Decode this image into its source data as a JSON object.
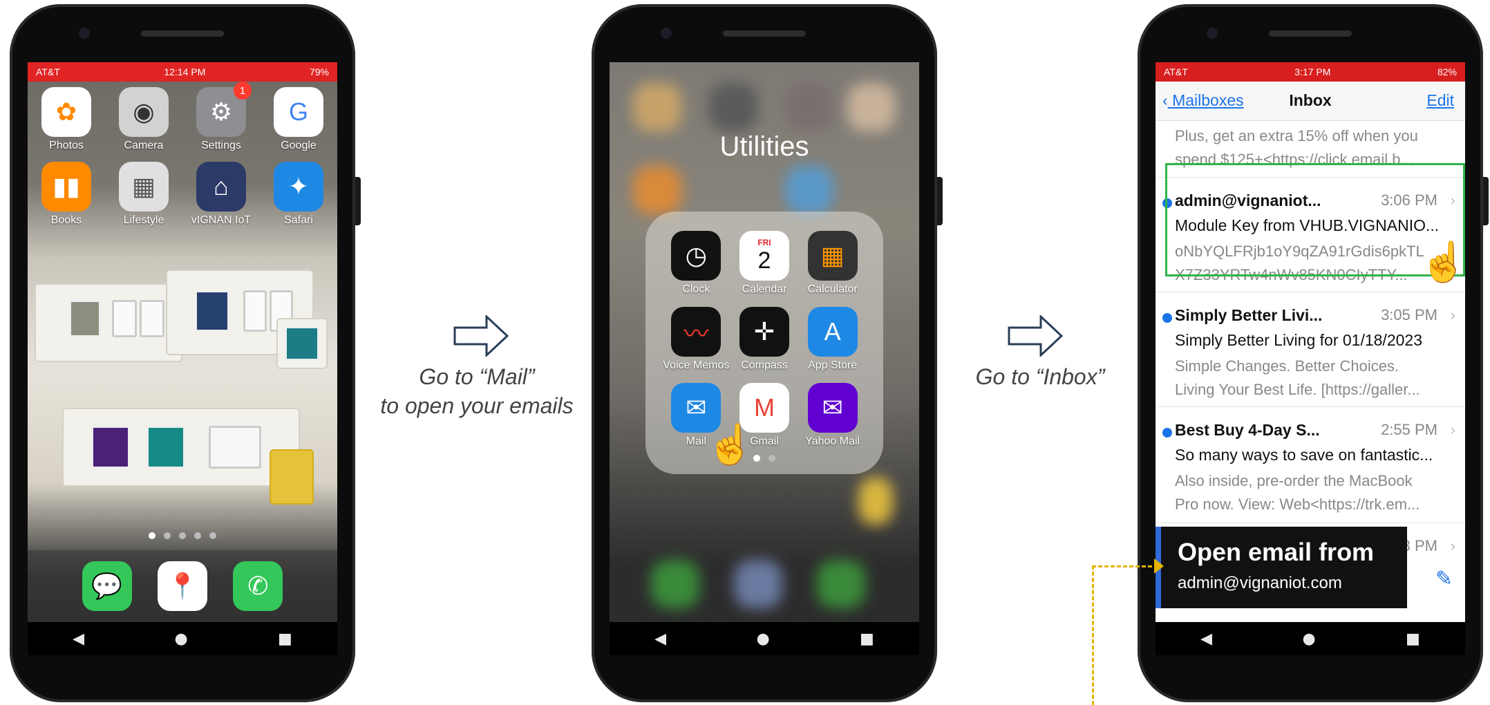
{
  "phone1": {
    "status": {
      "carrier": "AT&T",
      "time": "12:14 PM",
      "battery": "79%"
    },
    "apps": [
      {
        "label": "Photos",
        "icon": "photos-icon",
        "glyph": "✿",
        "bg": "#ffffff",
        "fg": "#ff8a00"
      },
      {
        "label": "Camera",
        "icon": "camera-icon",
        "glyph": "◉",
        "bg": "#d2d2d2",
        "fg": "#333333"
      },
      {
        "label": "Settings",
        "icon": "settings-icon",
        "glyph": "⚙",
        "bg": "#8e8e93",
        "fg": "#ffffff",
        "badge": "1"
      },
      {
        "label": "Google",
        "icon": "google-icon",
        "glyph": "G",
        "bg": "#ffffff",
        "fg": "#4285f4"
      },
      {
        "label": "Books",
        "icon": "books-icon",
        "glyph": "▮▮",
        "bg": "#ff8a00",
        "fg": "#ffffff"
      },
      {
        "label": "Lifestyle",
        "icon": "lifestyle-folder-icon",
        "glyph": "▦",
        "bg": "#e0e0e0",
        "fg": "#555555"
      },
      {
        "label": "vIGNAN IoT",
        "icon": "vignan-iot-icon",
        "glyph": "⌂",
        "bg": "#2b3a67",
        "fg": "#ffffff"
      },
      {
        "label": "Safari",
        "icon": "safari-icon",
        "glyph": "✦",
        "bg": "#1e88e5",
        "fg": "#ffffff"
      }
    ],
    "dock": [
      {
        "icon": "messages-icon",
        "glyph": "💬",
        "bg": "#34c759"
      },
      {
        "icon": "google-maps-icon",
        "glyph": "📍",
        "bg": "#ffffff"
      },
      {
        "icon": "phone-icon",
        "glyph": "✆",
        "bg": "#34c759"
      }
    ]
  },
  "step1": {
    "line1": "Go to “Mail”",
    "line2": "to open your emails"
  },
  "phone2": {
    "folder_title": "Utilities",
    "apps": [
      {
        "label": "Clock",
        "icon": "clock-icon",
        "glyph": "◷",
        "bg": "#111111",
        "fg": "#ffffff"
      },
      {
        "label": "Calendar",
        "icon": "calendar-icon",
        "glyph": "2",
        "bg": "#ffffff",
        "fg": "#111111",
        "day": "FRI"
      },
      {
        "label": "Calculator",
        "icon": "calculator-icon",
        "glyph": "▦",
        "bg": "#333333",
        "fg": "#ff9500"
      },
      {
        "label": "Voice Memos",
        "icon": "voice-memos-icon",
        "glyph": "〰",
        "bg": "#111111",
        "fg": "#ff3b30"
      },
      {
        "label": "Compass",
        "icon": "compass-icon",
        "glyph": "✛",
        "bg": "#111111",
        "fg": "#ffffff"
      },
      {
        "label": "App Store",
        "icon": "app-store-icon",
        "glyph": "A",
        "bg": "#1e88e5",
        "fg": "#ffffff"
      },
      {
        "label": "Mail",
        "icon": "mail-icon",
        "glyph": "✉",
        "bg": "#1e88e5",
        "fg": "#ffffff"
      },
      {
        "label": "Gmail",
        "icon": "gmail-icon",
        "glyph": "M",
        "bg": "#ffffff",
        "fg": "#ea4335"
      },
      {
        "label": "Yahoo Mail",
        "icon": "yahoo-mail-icon",
        "glyph": "✉",
        "bg": "#6001d2",
        "fg": "#ffffff"
      }
    ]
  },
  "step2": {
    "line1": "Go to “Inbox”"
  },
  "phone3": {
    "status": {
      "carrier": "AT&T",
      "time": "3:17 PM",
      "battery": "82%"
    },
    "nav": {
      "back": "Mailboxes",
      "title": "Inbox",
      "edit": "Edit"
    },
    "preview_top": [
      "Plus, get an extra 15% off when you",
      "spend $125+<https://click.email.b..."
    ],
    "messages": [
      {
        "from": "admin@vignaniot...",
        "time": "3:06 PM",
        "subject": "Module Key from VHUB.VIGNANIO...",
        "body": [
          "oNbYQLFRjb1oY9qZA91rGdis6pkTL",
          "X7Z33YRTw4nWv85KN0CIyTTY..."
        ]
      },
      {
        "from": "Simply Better Livi...",
        "time": "3:05 PM",
        "subject": "Simply Better Living for 01/18/2023",
        "body": [
          "Simple Changes. Better Choices.",
          "Living Your Best Life. [https://galler..."
        ]
      },
      {
        "from": "Best Buy 4-Day S...",
        "time": "2:55 PM",
        "subject": "So many ways to save on fantastic...",
        "body": [
          "Also inside, pre-order the MacBook",
          "Pro now. View: Web<https://trk.em..."
        ]
      }
    ],
    "last_time_fragment": "3 PM",
    "tooltip": {
      "title": "Open email from",
      "subtitle": "admin@vignaniot.com"
    }
  },
  "colors": {
    "status_red": "#e02424",
    "ios_blue": "#1a73e8",
    "highlight_green": "#2fb34a",
    "callout_yellow": "#e6b400"
  }
}
